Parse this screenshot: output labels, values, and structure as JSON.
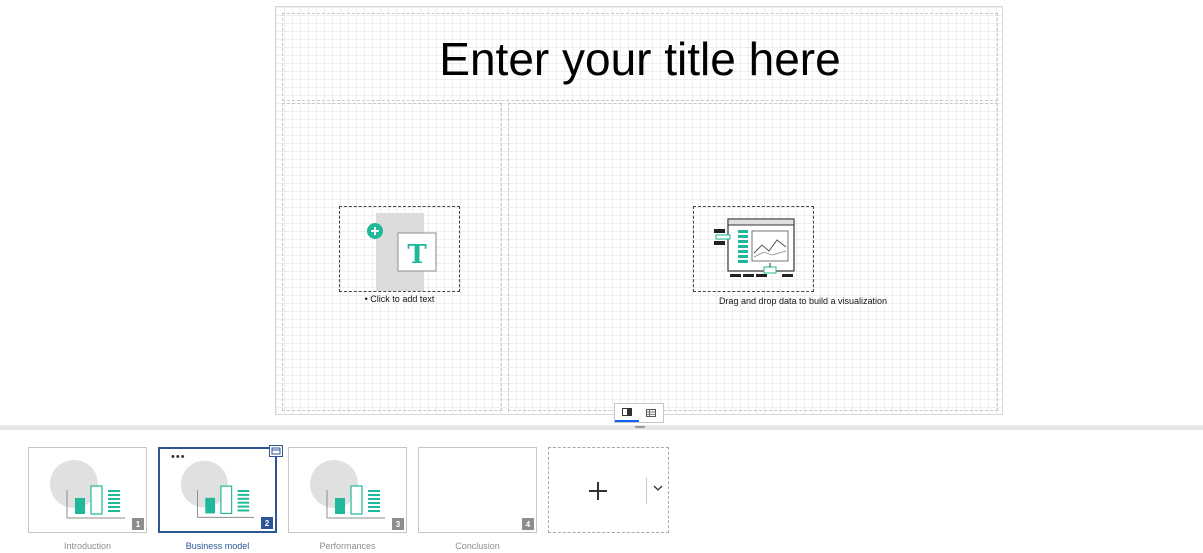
{
  "slide": {
    "title": "Enter your title here",
    "text_placeholder_caption": "• Click to add text",
    "visualization_placeholder_caption": "Drag and drop data to build a visualization"
  },
  "view_toggle": {
    "options": [
      "slide-view-icon",
      "grid-view-icon"
    ],
    "active": "slide-view-icon"
  },
  "thumbnails": [
    {
      "label": "Introduction",
      "number": "1",
      "selected": false
    },
    {
      "label": "Business model",
      "number": "2",
      "selected": true
    },
    {
      "label": "Performances",
      "number": "3",
      "selected": false
    },
    {
      "label": "Conclusion",
      "number": "4",
      "selected": false
    }
  ],
  "add_slide": {
    "icon": "plus-icon",
    "menu_icon": "chevron-down-icon"
  },
  "colors": {
    "accent": "#0f62fe",
    "selected": "#2d5594",
    "teal": "#1fb89a",
    "dark_teal": "#00897b"
  }
}
